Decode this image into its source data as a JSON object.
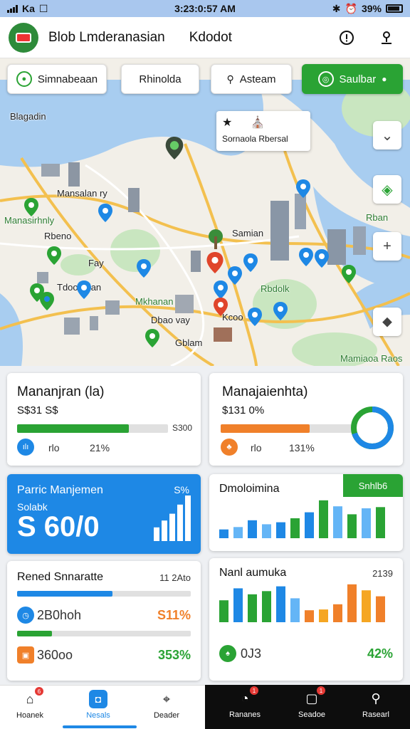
{
  "status": {
    "carrier": "Ka",
    "time": "3:23:0:57 AM",
    "battery": "39%"
  },
  "header": {
    "app_name": "Blob Lmderanasian",
    "subtitle": "Kdodot"
  },
  "map": {
    "chips": [
      {
        "label": "Simnabeaan",
        "icon": "location-chat-icon",
        "active": false
      },
      {
        "label": "Rhinolda",
        "icon": "",
        "active": false
      },
      {
        "label": "Asteam",
        "icon": "search-icon",
        "active": false
      },
      {
        "label": "Saulbar",
        "icon": "target-icon",
        "active": true
      }
    ],
    "callout": {
      "title": "Sornaola Rbersal",
      "icons": [
        "star-icon",
        "building-icon"
      ]
    },
    "labels": [
      {
        "text": "Blagadin"
      },
      {
        "text": "Mansalan ry"
      },
      {
        "text": "Manasirhnly"
      },
      {
        "text": "Rbeno"
      },
      {
        "text": "Fay"
      },
      {
        "text": "Tdoob dan"
      },
      {
        "text": "Samian"
      },
      {
        "text": "Rbdolk"
      },
      {
        "text": "Mkhanan"
      },
      {
        "text": "Dbao vay"
      },
      {
        "text": "Kcoo"
      },
      {
        "text": "Gblam"
      },
      {
        "text": "Rban"
      },
      {
        "text": "Mamiaoa Raos"
      }
    ]
  },
  "cards": {
    "card1": {
      "title": "Mananjran (la)",
      "value": "S$31 S$",
      "progress": 0.74,
      "progress_label": "S300",
      "foot_label": "rlo",
      "foot_value": "21%",
      "color": "#2aa334"
    },
    "card2": {
      "title": "Manajaienhta)",
      "value": "$131 0%",
      "progress": 0.66,
      "foot_label": "rlo",
      "foot_value": "131%",
      "ring_percent": 0.7
    },
    "card3": {
      "title": "Parric Manjemen",
      "pct": "S%",
      "sub": "Solabk",
      "big": "S 60/0",
      "bars": [
        0.3,
        0.45,
        0.6,
        0.8,
        1.0
      ]
    },
    "card4": {
      "title": "Dmoloimina",
      "tag": "Snhlb6",
      "bars": [
        {
          "v": 0.22,
          "c": "#1e88e5"
        },
        {
          "v": 0.28,
          "c": "#64b5f6"
        },
        {
          "v": 0.45,
          "c": "#1e88e5"
        },
        {
          "v": 0.35,
          "c": "#64b5f6"
        },
        {
          "v": 0.4,
          "c": "#1e88e5"
        },
        {
          "v": 0.5,
          "c": "#2aa334"
        },
        {
          "v": 0.65,
          "c": "#1e88e5"
        },
        {
          "v": 0.95,
          "c": "#2aa334"
        },
        {
          "v": 0.8,
          "c": "#64b5f6"
        },
        {
          "v": 0.6,
          "c": "#2aa334"
        },
        {
          "v": 0.75,
          "c": "#64b5f6"
        },
        {
          "v": 0.78,
          "c": "#2aa334"
        }
      ]
    },
    "card5": {
      "title": "Rened Snnaratte",
      "value": "11 2Ato",
      "rows": [
        {
          "label": "2B0hoh",
          "pct": "S11%",
          "pct_color": "#f0802a",
          "progress": 0.55,
          "icon_color": "#1e88e5"
        },
        {
          "label": "360oo",
          "pct": "353%",
          "pct_color": "#2aa334",
          "progress": 0.2,
          "icon_color": "#f0802a"
        }
      ]
    },
    "card6": {
      "title": "Nanl aumuka",
      "value": "2139",
      "foot_label": "0J3",
      "foot_pct": "42%",
      "bars": [
        {
          "v": 0.55,
          "c": "#2aa334"
        },
        {
          "v": 0.85,
          "c": "#1e88e5"
        },
        {
          "v": 0.7,
          "c": "#2aa334"
        },
        {
          "v": 0.78,
          "c": "#2aa334"
        },
        {
          "v": 0.9,
          "c": "#1e88e5"
        },
        {
          "v": 0.6,
          "c": "#64b5f6"
        },
        {
          "v": 0.3,
          "c": "#f0802a"
        },
        {
          "v": 0.32,
          "c": "#f5a623"
        },
        {
          "v": 0.45,
          "c": "#f0802a"
        },
        {
          "v": 0.95,
          "c": "#f0802a"
        },
        {
          "v": 0.8,
          "c": "#f5a623"
        },
        {
          "v": 0.65,
          "c": "#f0802a"
        }
      ]
    }
  },
  "nav": {
    "left": [
      {
        "label": "Hoanek",
        "icon": "home-icon",
        "badge": "6"
      },
      {
        "label": "Nesals",
        "icon": "messages-icon",
        "badge": ""
      },
      {
        "label": "Deader",
        "icon": "navigation-icon",
        "badge": ""
      }
    ],
    "right": [
      {
        "label": "Rananes",
        "icon": "clock-icon",
        "badge": "1"
      },
      {
        "label": "Seadoe",
        "icon": "calendar-icon",
        "badge": "1"
      },
      {
        "label": "Rasearl",
        "icon": "search-icon",
        "badge": ""
      }
    ]
  },
  "colors": {
    "accent_green": "#2aa334",
    "accent_blue": "#1e88e5",
    "accent_orange": "#f0802a",
    "water": "#a8cdf0"
  }
}
